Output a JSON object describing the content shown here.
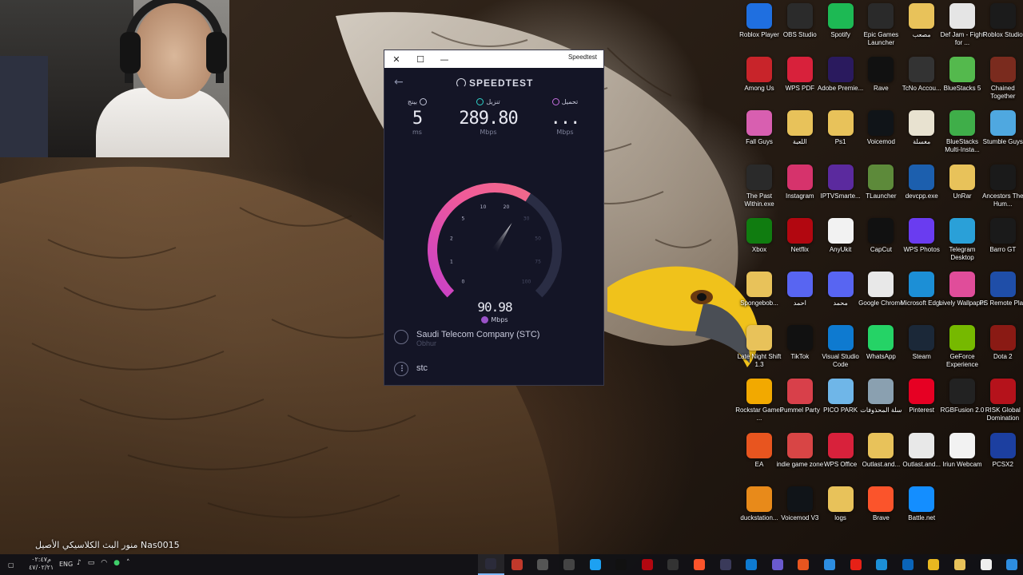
{
  "speedtest": {
    "window_title": "Speedtest",
    "logo": "SPEEDTEST",
    "ping": {
      "label": "بينج",
      "value": "5",
      "unit": "ms"
    },
    "download": {
      "label": "تنزيل",
      "value": "289.80",
      "unit": "Mbps"
    },
    "upload": {
      "label": "تحميل",
      "value": "...",
      "unit": "Mbps"
    },
    "gauge": {
      "ticks": [
        "0",
        "1",
        "2",
        "5",
        "10",
        "20",
        "30",
        "50",
        "75",
        "100"
      ],
      "current_value": "90.98",
      "current_unit": "Mbps",
      "fraction": 0.62
    },
    "isp": {
      "name": "Saudi Telecom Company (STC)",
      "location": "Obhur"
    },
    "server": {
      "name": "stc"
    }
  },
  "desktop_icons": [
    {
      "label": "Roblox Player",
      "color": "#1f6fe0"
    },
    {
      "label": "OBS Studio",
      "color": "#2b2b2b"
    },
    {
      "label": "Spotify",
      "color": "#1db954"
    },
    {
      "label": "Epic Games Launcher",
      "color": "#2a2a2a"
    },
    {
      "label": "مصعب",
      "color": "#e8c25a"
    },
    {
      "label": "Def Jam - Fight for ...",
      "color": "#e5e5e5"
    },
    {
      "label": "Roblox Studio",
      "color": "#1b1b1b"
    },
    {
      "label": "Among Us",
      "color": "#c8242a"
    },
    {
      "label": "WPS PDF",
      "color": "#d8213b"
    },
    {
      "label": "Adobe Premie...",
      "color": "#2a1a5e"
    },
    {
      "label": "Rave",
      "color": "#111111"
    },
    {
      "label": "TcNo Accou...",
      "color": "#333333"
    },
    {
      "label": "BlueStacks 5",
      "color": "#54b94d"
    },
    {
      "label": "Chained Together",
      "color": "#7a2b1e"
    },
    {
      "label": "Fall Guys",
      "color": "#d85fb0"
    },
    {
      "label": "اللعبة",
      "color": "#e8c25a"
    },
    {
      "label": "Ps1",
      "color": "#e8c25a"
    },
    {
      "label": "Voicemod",
      "color": "#101418"
    },
    {
      "label": "مغسلة",
      "color": "#e8e2d0"
    },
    {
      "label": "BlueStacks Multi-Insta...",
      "color": "#3fae49"
    },
    {
      "label": "Stumble Guys",
      "color": "#4fa8e0"
    },
    {
      "label": "The Past Within.exe",
      "color": "#2a2a2a"
    },
    {
      "label": "Instagram",
      "color": "#d6336c"
    },
    {
      "label": "IPTVSmarte...",
      "color": "#5b2a9e"
    },
    {
      "label": "TLauncher",
      "color": "#5d8a3a"
    },
    {
      "label": "devcpp.exe",
      "color": "#1c5fae"
    },
    {
      "label": "UnRar",
      "color": "#e8c25a"
    },
    {
      "label": "Ancestors The Hum...",
      "color": "#1a1a1a"
    },
    {
      "label": "Xbox",
      "color": "#107c10"
    },
    {
      "label": "Netflix",
      "color": "#b20710"
    },
    {
      "label": "AnyUkit",
      "color": "#f2f2f2"
    },
    {
      "label": "CapCut",
      "color": "#111111"
    },
    {
      "label": "WPS Photos",
      "color": "#6a3cf0"
    },
    {
      "label": "Telegram Desktop",
      "color": "#2aa0d8"
    },
    {
      "label": "Barro GT",
      "color": "#1a1a1a"
    },
    {
      "label": "Spongebob...",
      "color": "#e8c25a"
    },
    {
      "label": "احمد",
      "color": "#5865f2"
    },
    {
      "label": "محمد",
      "color": "#5865f2"
    },
    {
      "label": "Google Chrome",
      "color": "#e8e8e8"
    },
    {
      "label": "Microsoft Edge",
      "color": "#1c8fd6"
    },
    {
      "label": "Lively Wallpaper",
      "color": "#e04d9a"
    },
    {
      "label": "PS Remote Play",
      "color": "#1f4ea8"
    },
    {
      "label": "Late Night Shift 1.3",
      "color": "#e8c25a"
    },
    {
      "label": "TikTok",
      "color": "#111111"
    },
    {
      "label": "Visual Studio Code",
      "color": "#0e7ad0"
    },
    {
      "label": "WhatsApp",
      "color": "#25d366"
    },
    {
      "label": "Steam",
      "color": "#1b2838"
    },
    {
      "label": "GeForce Experience",
      "color": "#76b900"
    },
    {
      "label": "Dota 2",
      "color": "#8a1a14"
    },
    {
      "label": "Rockstar Games ...",
      "color": "#f2a900"
    },
    {
      "label": "Pummel Party",
      "color": "#d8404a"
    },
    {
      "label": "PICO PARK",
      "color": "#6fb6e8"
    },
    {
      "label": "سلة المحذوفات",
      "color": "#8aa0b0"
    },
    {
      "label": "Pinterest",
      "color": "#e60023"
    },
    {
      "label": "RGBFusion 2.0",
      "color": "#222222"
    },
    {
      "label": "RISK Global Domination",
      "color": "#b5121b"
    },
    {
      "label": "EA",
      "color": "#e8551f"
    },
    {
      "label": "indie game zone",
      "color": "#d84545"
    },
    {
      "label": "WPS Office",
      "color": "#d8213b"
    },
    {
      "label": "Outlast.and...",
      "color": "#e8c25a"
    },
    {
      "label": "Outlast.and...",
      "color": "#e8e8e8"
    },
    {
      "label": "Iriun Webcam",
      "color": "#f2f2f2"
    },
    {
      "label": "PCSX2",
      "color": "#1c3fa0"
    },
    {
      "label": "duckstation...",
      "color": "#e88a1a"
    },
    {
      "label": "Voicemod V3",
      "color": "#101418"
    },
    {
      "label": "logs",
      "color": "#e8c25a"
    },
    {
      "label": "Brave",
      "color": "#fb542b"
    },
    {
      "label": "Battle.net",
      "color": "#148eff"
    }
  ],
  "stream_overlay": {
    "text": "منور البث الكلاسيكي الأصيل Nas0015"
  },
  "taskbar": {
    "lang": "ENG",
    "clock_time": "م٠٢:٤٧",
    "clock_date": "٤٧/٠٢/٢١",
    "apps": [
      {
        "name": "speedtest-taskbar-icon",
        "color": "#2b2b3a",
        "active": true
      },
      {
        "name": "obs-taskbar-icon",
        "color": "#c0392b",
        "active": false
      },
      {
        "name": "settings-taskbar-icon",
        "color": "#555555",
        "active": false
      },
      {
        "name": "speedtest2-taskbar-icon",
        "color": "#444444",
        "active": false
      },
      {
        "name": "twitter-taskbar-icon",
        "color": "#1da1f2",
        "active": false
      },
      {
        "name": "tiktok-taskbar-icon",
        "color": "#111111",
        "active": false
      },
      {
        "name": "netflix-taskbar-icon",
        "color": "#b20710",
        "active": false
      },
      {
        "name": "epic-taskbar-icon",
        "color": "#333333",
        "active": false
      },
      {
        "name": "brave-taskbar-icon",
        "color": "#fb542b",
        "active": false
      },
      {
        "name": "app-taskbar-icon",
        "color": "#3a3a5a",
        "active": false
      },
      {
        "name": "vscode-taskbar-icon",
        "color": "#0e7ad0",
        "active": false
      },
      {
        "name": "game-taskbar-icon",
        "color": "#6a5acd",
        "active": false
      },
      {
        "name": "origin-taskbar-icon",
        "color": "#e8551f",
        "active": false
      },
      {
        "name": "store-taskbar-icon",
        "color": "#2d8de0",
        "active": false
      },
      {
        "name": "youtube-taskbar-icon",
        "color": "#e62117",
        "active": false
      },
      {
        "name": "edge-taskbar-icon",
        "color": "#1c8fd6",
        "active": false
      },
      {
        "name": "outlook-taskbar-icon",
        "color": "#0a64b8",
        "active": false
      },
      {
        "name": "chrome-taskbar-icon",
        "color": "#e8b820",
        "active": false
      },
      {
        "name": "explorer-taskbar-icon",
        "color": "#e8c25a",
        "active": false
      },
      {
        "name": "search-taskbar-icon",
        "color": "#eeeeee",
        "active": false
      },
      {
        "name": "start-taskbar-icon",
        "color": "#2d8de0",
        "active": false
      }
    ]
  }
}
